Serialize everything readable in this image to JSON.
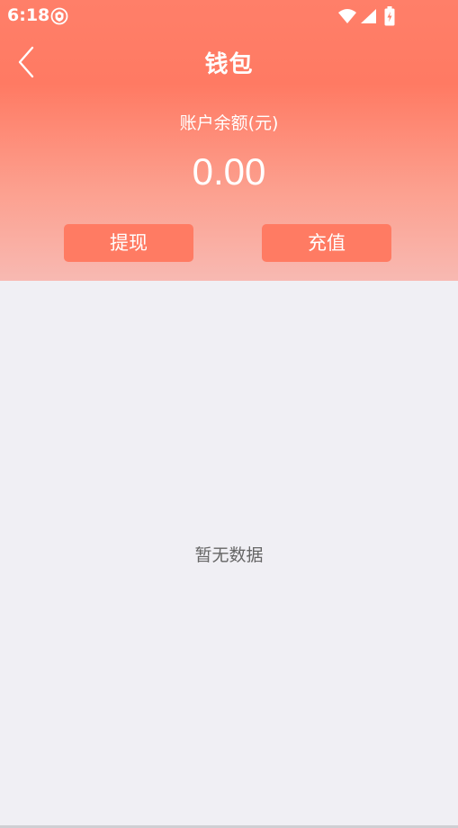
{
  "status_bar": {
    "time": "6:18",
    "icons": [
      "app-badge-icon",
      "wifi-icon",
      "signal-icon",
      "battery-icon"
    ]
  },
  "header": {
    "title": "钱包",
    "back_icon": "chevron-left-icon",
    "balance_label": "账户余额(元)",
    "balance_value": "0.00",
    "withdraw_label": "提现",
    "recharge_label": "充值",
    "colors": {
      "gradient_top": "#ff7f69",
      "gradient_bottom": "#f8b9b2",
      "button_bg": "#ff7b63"
    }
  },
  "content": {
    "empty_text": "暂无数据"
  }
}
